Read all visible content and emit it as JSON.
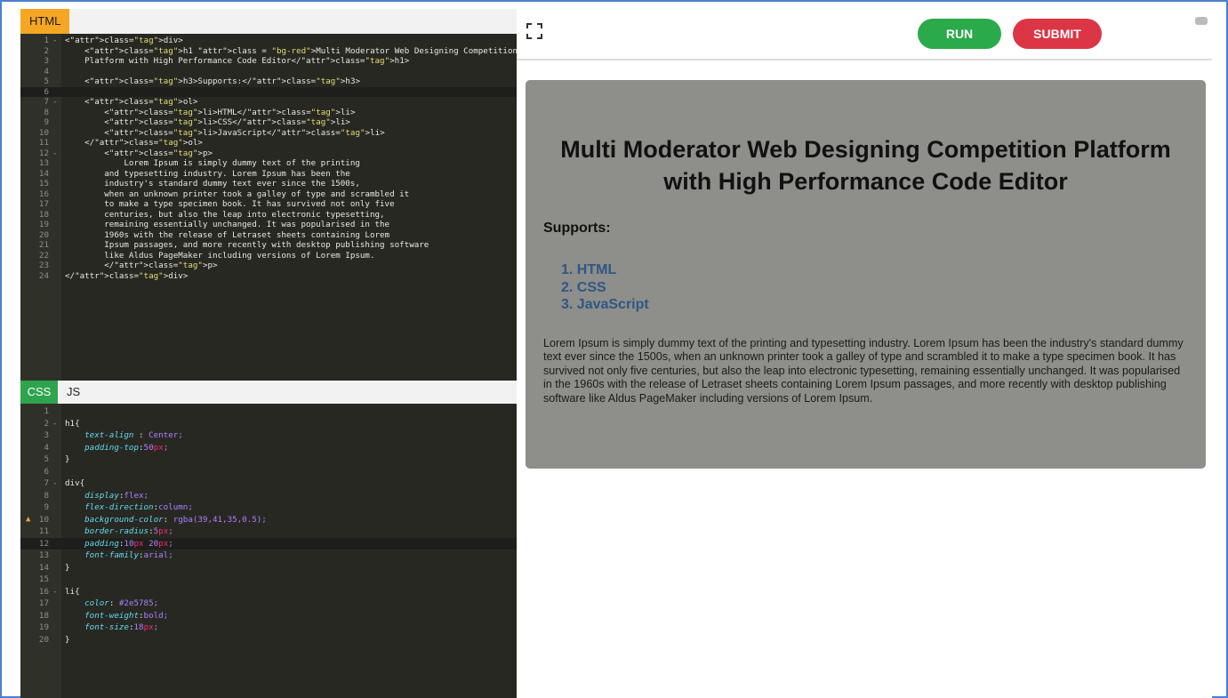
{
  "tabs": {
    "html": "HTML",
    "css": "CSS",
    "js": "JS"
  },
  "toolbar": {
    "run_label": "RUN",
    "submit_label": "SUBMIT"
  },
  "preview": {
    "heading": "Multi Moderator Web Designing Competition Platform with High Performance Code Editor",
    "supports_label": "Supports:",
    "list_items": [
      "1. HTML",
      "2. CSS",
      "3. JavaScript"
    ],
    "paragraph": "Lorem Ipsum is simply dummy text of the printing and typesetting industry. Lorem Ipsum has been the industry's standard dummy text ever since the 1500s, when an unknown printer took a galley of type and scrambled it to make a type specimen book. It has survived not only five centuries, but also the leap into electronic typesetting, remaining essentially unchanged. It was popularised in the 1960s with the release of Letraset sheets containing Lorem Ipsum passages, and more recently with desktop publishing software like Aldus PageMaker including versions of Lorem Ipsum."
  },
  "colors": {
    "run": "#2aaa4a",
    "submit": "#dc3545",
    "html_tab": "#f5a623",
    "css_tab": "#2ea44f",
    "editor_bg": "#272822",
    "preview_bg": "#8e8e8a",
    "list_color": "#2e5785"
  },
  "html_code": [
    {
      "n": "1",
      "fold": "-",
      "code": "<div>"
    },
    {
      "n": "2",
      "fold": "",
      "code": "    <h1 class = \"bg-red\">Multi Moderator Web Designing Competition"
    },
    {
      "n": "3",
      "fold": "",
      "code": "    Platform with High Performance Code Editor</h1>"
    },
    {
      "n": "4",
      "fold": "",
      "code": ""
    },
    {
      "n": "5",
      "fold": "",
      "code": "    <h3>Supports:</h3>"
    },
    {
      "n": "6",
      "fold": "",
      "code": ""
    },
    {
      "n": "7",
      "fold": "-",
      "code": "    <ol>"
    },
    {
      "n": "8",
      "fold": "",
      "code": "        <li>HTML</li>"
    },
    {
      "n": "9",
      "fold": "",
      "code": "        <li>CSS</li>"
    },
    {
      "n": "10",
      "fold": "",
      "code": "        <li>JavaScript</li>"
    },
    {
      "n": "11",
      "fold": "",
      "code": "    </ol>"
    },
    {
      "n": "12",
      "fold": "-",
      "code": "        <p>"
    },
    {
      "n": "13",
      "fold": "",
      "code": "            Lorem Ipsum is simply dummy text of the printing"
    },
    {
      "n": "14",
      "fold": "",
      "code": "        and typesetting industry. Lorem Ipsum has been the"
    },
    {
      "n": "15",
      "fold": "",
      "code": "        industry's standard dummy text ever since the 1500s,"
    },
    {
      "n": "16",
      "fold": "",
      "code": "        when an unknown printer took a galley of type and scrambled it"
    },
    {
      "n": "17",
      "fold": "",
      "code": "        to make a type specimen book. It has survived not only five"
    },
    {
      "n": "18",
      "fold": "",
      "code": "        centuries, but also the leap into electronic typesetting,"
    },
    {
      "n": "19",
      "fold": "",
      "code": "        remaining essentially unchanged. It was popularised in the"
    },
    {
      "n": "20",
      "fold": "",
      "code": "        1960s with the release of Letraset sheets containing Lorem"
    },
    {
      "n": "21",
      "fold": "",
      "code": "        Ipsum passages, and more recently with desktop publishing software"
    },
    {
      "n": "22",
      "fold": "",
      "code": "        like Aldus PageMaker including versions of Lorem Ipsum."
    },
    {
      "n": "23",
      "fold": "",
      "code": "        </p>"
    },
    {
      "n": "24",
      "fold": "",
      "code": "</div>"
    }
  ],
  "css_code": [
    {
      "n": "1",
      "fold": "",
      "code": ""
    },
    {
      "n": "2",
      "fold": "-",
      "code": "h1{"
    },
    {
      "n": "3",
      "fold": "",
      "code": "    text-align : Center;"
    },
    {
      "n": "4",
      "fold": "",
      "code": "    padding-top:50px;"
    },
    {
      "n": "5",
      "fold": "",
      "code": "}"
    },
    {
      "n": "6",
      "fold": "",
      "code": ""
    },
    {
      "n": "7",
      "fold": "-",
      "code": "div{"
    },
    {
      "n": "8",
      "fold": "",
      "code": "    display:flex;"
    },
    {
      "n": "9",
      "fold": "",
      "code": "    flex-direction:column;"
    },
    {
      "n": "10",
      "fold": "",
      "code": "    background-color: rgba(39,41,35,0.5);"
    },
    {
      "n": "11",
      "fold": "",
      "code": "    border-radius:5px;"
    },
    {
      "n": "12",
      "fold": "",
      "code": "    padding:10px 20px;"
    },
    {
      "n": "13",
      "fold": "",
      "code": "    font-family:arial;"
    },
    {
      "n": "14",
      "fold": "",
      "code": "}"
    },
    {
      "n": "15",
      "fold": "",
      "code": ""
    },
    {
      "n": "16",
      "fold": "-",
      "code": "li{"
    },
    {
      "n": "17",
      "fold": "",
      "code": "    color: #2e5785;"
    },
    {
      "n": "18",
      "fold": "",
      "code": "    font-weight:bold;"
    },
    {
      "n": "19",
      "fold": "",
      "code": "    font-size:18px;"
    },
    {
      "n": "20",
      "fold": "",
      "code": "}"
    }
  ]
}
